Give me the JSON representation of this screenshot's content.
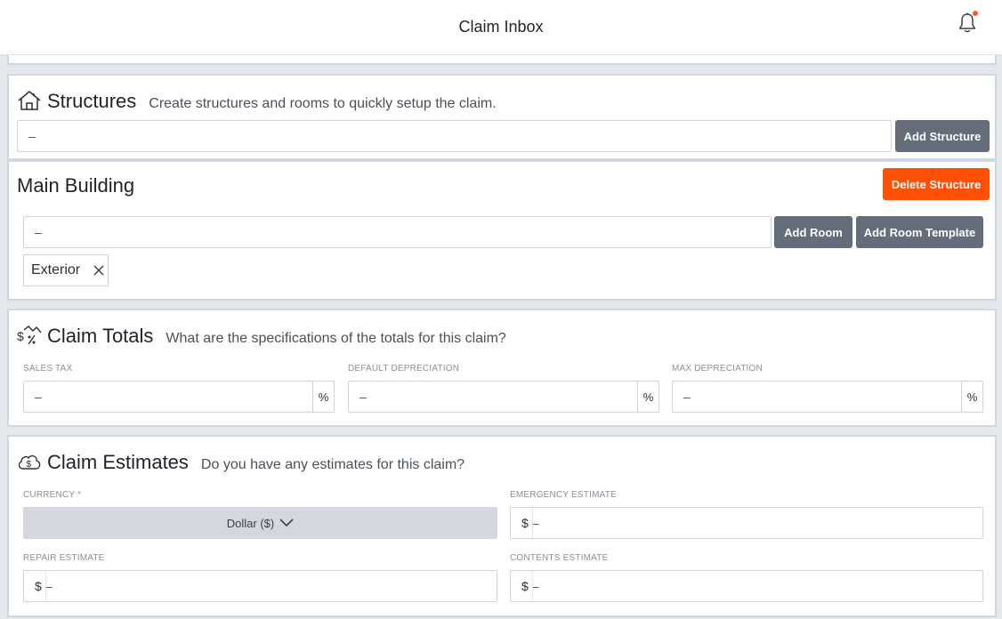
{
  "header": {
    "title": "Claim Inbox"
  },
  "structures": {
    "title": "Structures",
    "subtitle": "Create structures and rooms to quickly setup the claim.",
    "input_value": "–",
    "add_button": "Add Structure"
  },
  "structure_item": {
    "name": "Main Building",
    "delete_button": "Delete Structure",
    "room_input_value": "–",
    "add_room_button": "Add Room",
    "add_room_template_button": "Add Room Template",
    "rooms": [
      {
        "label": "Exterior"
      }
    ]
  },
  "claim_totals": {
    "title": "Claim Totals",
    "subtitle": "What are the specifications of the totals for this claim?",
    "fields": [
      {
        "label": "SALES TAX",
        "value": "–",
        "suffix": "%"
      },
      {
        "label": "DEFAULT DEPRECIATION",
        "value": "–",
        "suffix": "%"
      },
      {
        "label": "MAX DEPRECIATION",
        "value": "–",
        "suffix": "%"
      }
    ]
  },
  "claim_estimates": {
    "title": "Claim Estimates",
    "subtitle": "Do you have any estimates for this claim?",
    "currency": {
      "label": "CURRENCY *",
      "value": "Dollar ($)"
    },
    "emergency": {
      "label": "EMERGENCY ESTIMATE",
      "symbol": "$",
      "value": "–"
    },
    "repair": {
      "label": "REPAIR ESTIMATE",
      "symbol": "$",
      "value": "–"
    },
    "contents": {
      "label": "CONTENTS ESTIMATE",
      "symbol": "$",
      "value": "–"
    }
  },
  "colors": {
    "accent_danger": "#ff5008",
    "button_gray": "#646d7a",
    "notification_dot": "#ff5a1f"
  },
  "icons": [
    "bell-icon",
    "house-icon",
    "close-icon",
    "money-tag-icon",
    "cloud-dollar-icon",
    "chevron-down-icon"
  ]
}
